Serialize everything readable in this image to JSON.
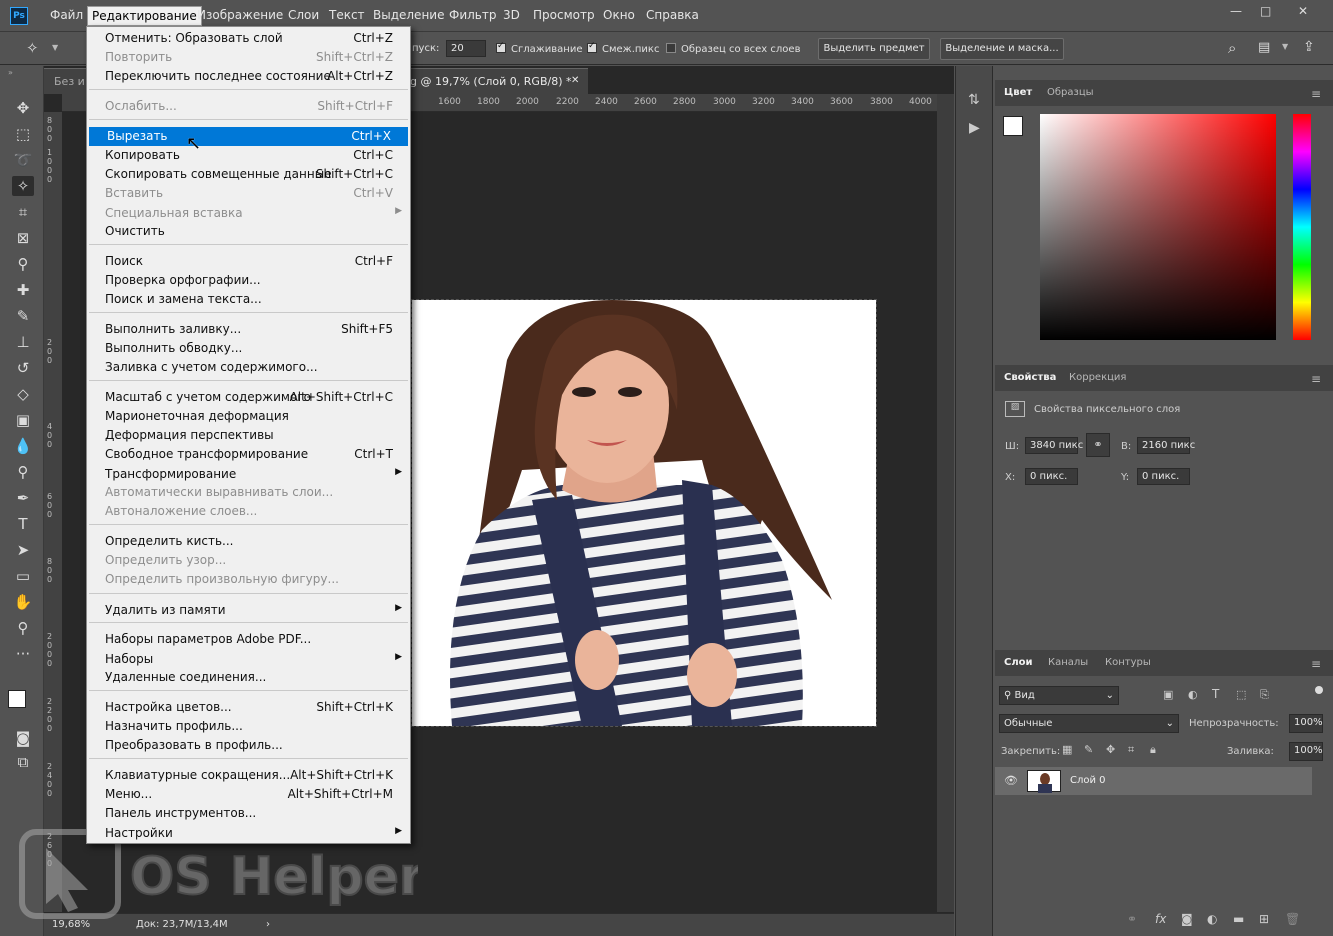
{
  "app": {
    "logo": "Ps"
  },
  "menubar": {
    "items": [
      "Файл",
      "Редактирование",
      "Изображение",
      "Слои",
      "Текст",
      "Выделение",
      "Фильтр",
      "3D",
      "Просмотр",
      "Окно",
      "Справка"
    ],
    "active": "Редактирование"
  },
  "options": {
    "tolerance_label": "пуск:",
    "tolerance_value": "20",
    "antialias_label": "Сглаживание",
    "contiguous_label": "Смеж.пикс",
    "sample_all_label": "Образец со всех слоев",
    "select_subject": "Выделить предмет",
    "select_mask": "Выделение и маска..."
  },
  "document": {
    "tab_left": "Без и",
    "tab_title": "g @ 19,7% (Слой 0, RGB/8) *",
    "ruler_ticks": [
      "1600",
      "1800",
      "2000",
      "2200",
      "2400",
      "2600",
      "2800",
      "3000",
      "3200",
      "3400",
      "3600",
      "3800",
      "4000"
    ],
    "vruler_ticks": [
      "8 0 0",
      "1 0 0 0",
      "2 0 0",
      "4 0 0",
      "6 0 0",
      "8 0 0",
      "2 0 0 0",
      "2 2 0 0",
      "2 4 0 0",
      "2 6 0 0",
      "2 8 0 0",
      "3 0 0 0"
    ],
    "zoom": "19,68%",
    "doc_size": "Док: 23,7M/13,4M"
  },
  "edit_menu": [
    {
      "label": "Отменить: Образовать слой",
      "shortcut": "Ctrl+Z",
      "disabled": false
    },
    {
      "label": "Повторить",
      "shortcut": "Shift+Ctrl+Z",
      "disabled": true
    },
    {
      "label": "Переключить последнее состояние",
      "shortcut": "Alt+Ctrl+Z",
      "disabled": false
    },
    {
      "sep": true
    },
    {
      "label": "Ослабить...",
      "shortcut": "Shift+Ctrl+F",
      "disabled": true
    },
    {
      "sep": true
    },
    {
      "label": "Вырезать",
      "shortcut": "Ctrl+X",
      "disabled": false,
      "highlight": true
    },
    {
      "label": "Копировать",
      "shortcut": "Ctrl+C",
      "disabled": false
    },
    {
      "label": "Скопировать совмещенные данные",
      "shortcut": "Shift+Ctrl+C",
      "disabled": false
    },
    {
      "label": "Вставить",
      "shortcut": "Ctrl+V",
      "disabled": true
    },
    {
      "label": "Специальная вставка",
      "shortcut": "",
      "disabled": true,
      "submenu": true
    },
    {
      "label": "Очистить",
      "shortcut": "",
      "disabled": false
    },
    {
      "sep": true
    },
    {
      "label": "Поиск",
      "shortcut": "Ctrl+F",
      "disabled": false
    },
    {
      "label": "Проверка орфографии...",
      "shortcut": "",
      "disabled": false
    },
    {
      "label": "Поиск и замена текста...",
      "shortcut": "",
      "disabled": false
    },
    {
      "sep": true
    },
    {
      "label": "Выполнить заливку...",
      "shortcut": "Shift+F5",
      "disabled": false
    },
    {
      "label": "Выполнить обводку...",
      "shortcut": "",
      "disabled": false
    },
    {
      "label": "Заливка с учетом содержимого...",
      "shortcut": "",
      "disabled": false
    },
    {
      "sep": true
    },
    {
      "label": "Масштаб с учетом содержимого",
      "shortcut": "Alt+Shift+Ctrl+C",
      "disabled": false
    },
    {
      "label": "Марионеточная деформация",
      "shortcut": "",
      "disabled": false
    },
    {
      "label": "Деформация перспективы",
      "shortcut": "",
      "disabled": false
    },
    {
      "label": "Свободное трансформирование",
      "shortcut": "Ctrl+T",
      "disabled": false
    },
    {
      "label": "Трансформирование",
      "shortcut": "",
      "disabled": false,
      "submenu": true
    },
    {
      "label": "Автоматически выравнивать слои...",
      "shortcut": "",
      "disabled": true
    },
    {
      "label": "Автоналожение слоев...",
      "shortcut": "",
      "disabled": true
    },
    {
      "sep": true
    },
    {
      "label": "Определить кисть...",
      "shortcut": "",
      "disabled": false
    },
    {
      "label": "Определить узор...",
      "shortcut": "",
      "disabled": true
    },
    {
      "label": "Определить произвольную фигуру...",
      "shortcut": "",
      "disabled": true
    },
    {
      "sep": true
    },
    {
      "label": "Удалить из памяти",
      "shortcut": "",
      "disabled": false,
      "submenu": true
    },
    {
      "sep": true
    },
    {
      "label": "Наборы параметров Adobe PDF...",
      "shortcut": "",
      "disabled": false
    },
    {
      "label": "Наборы",
      "shortcut": "",
      "disabled": false,
      "submenu": true
    },
    {
      "label": "Удаленные соединения...",
      "shortcut": "",
      "disabled": false
    },
    {
      "sep": true
    },
    {
      "label": "Настройка цветов...",
      "shortcut": "Shift+Ctrl+K",
      "disabled": false
    },
    {
      "label": "Назначить профиль...",
      "shortcut": "",
      "disabled": false
    },
    {
      "label": "Преобразовать в профиль...",
      "shortcut": "",
      "disabled": false
    },
    {
      "sep": true
    },
    {
      "label": "Клавиатурные сокращения...",
      "shortcut": "Alt+Shift+Ctrl+K",
      "disabled": false
    },
    {
      "label": "Меню...",
      "shortcut": "Alt+Shift+Ctrl+M",
      "disabled": false
    },
    {
      "label": "Панель инструментов...",
      "shortcut": "",
      "disabled": false
    },
    {
      "label": "Настройки",
      "shortcut": "",
      "disabled": false,
      "submenu": true
    }
  ],
  "color_panel": {
    "tabs": [
      "Цвет",
      "Образцы"
    ],
    "active": "Цвет",
    "hue_color": "#ff0000"
  },
  "properties_panel": {
    "tabs": [
      "Свойства",
      "Коррекция"
    ],
    "active": "Свойства",
    "header": "Свойства пиксельного слоя",
    "w_label": "Ш:",
    "w_value": "3840 пикс",
    "h_label": "В:",
    "h_value": "2160 пикс",
    "x_label": "X:",
    "x_value": "0 пикс.",
    "y_label": "Y:",
    "y_value": "0 пикс."
  },
  "layers_panel": {
    "tabs": [
      "Слои",
      "Каналы",
      "Контуры"
    ],
    "active": "Слои",
    "filter": "Вид",
    "blend_mode": "Обычные",
    "opacity_label": "Непрозрачность:",
    "opacity": "100%",
    "lock_label": "Закрепить:",
    "fill_label": "Заливка:",
    "fill": "100%",
    "layers": [
      {
        "name": "Слой 0",
        "visible": true
      }
    ]
  },
  "watermark": {
    "text": "OS Helper"
  }
}
